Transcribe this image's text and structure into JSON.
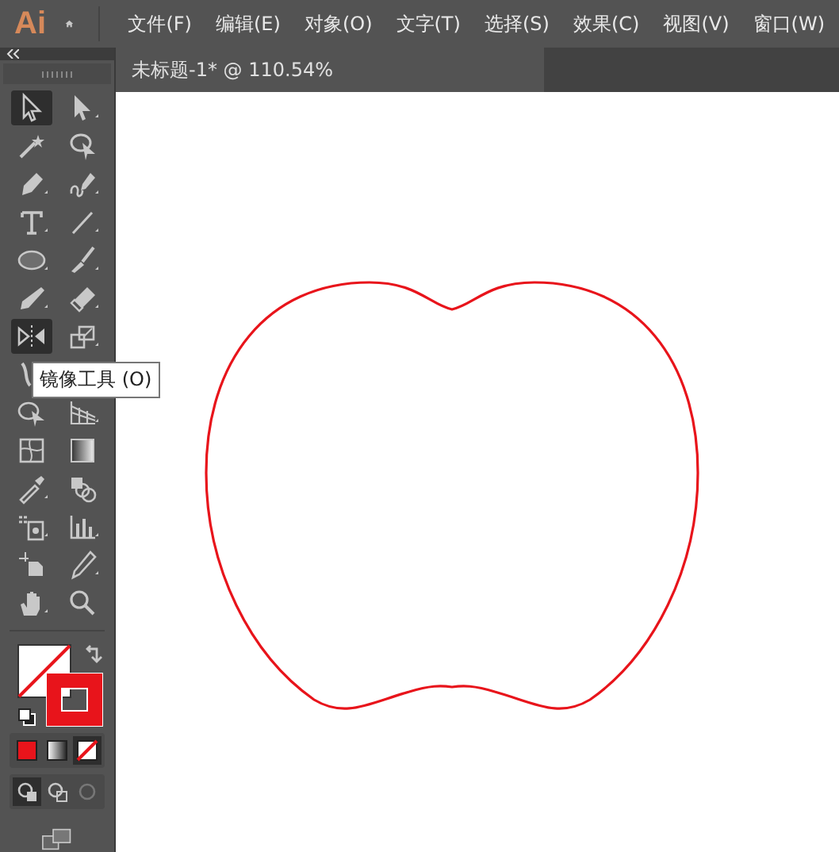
{
  "app": {
    "logo": "Ai"
  },
  "menu": [
    "文件(F)",
    "编辑(E)",
    "对象(O)",
    "文字(T)",
    "选择(S)",
    "效果(C)",
    "视图(V)",
    "窗口(W)"
  ],
  "document_tab": {
    "title": "未标题-1* @ 110.54%"
  },
  "tool_rows": [
    [
      {
        "kind": "selection",
        "selected": true
      },
      {
        "kind": "direct",
        "selected": false
      }
    ],
    [
      {
        "kind": "wand",
        "selected": false
      },
      {
        "kind": "lasso",
        "selected": false
      }
    ],
    [
      {
        "kind": "pen",
        "selected": false
      },
      {
        "kind": "curvature",
        "selected": false
      }
    ],
    [
      {
        "kind": "type",
        "selected": false
      },
      {
        "kind": "line",
        "selected": false
      }
    ],
    [
      {
        "kind": "ellipse",
        "selected": false
      },
      {
        "kind": "brush",
        "selected": false
      }
    ],
    [
      {
        "kind": "pencil",
        "selected": false
      },
      {
        "kind": "eraser",
        "selected": false
      }
    ],
    [
      {
        "kind": "reflect",
        "selected": true
      },
      {
        "kind": "scale",
        "selected": false
      }
    ],
    [
      {
        "kind": "width",
        "selected": false
      }
    ],
    [
      {
        "kind": "builder",
        "selected": false
      },
      {
        "kind": "perspective",
        "selected": false
      }
    ],
    [
      {
        "kind": "mesh",
        "selected": false
      },
      {
        "kind": "gradient",
        "selected": false
      }
    ],
    [
      {
        "kind": "eyedropper",
        "selected": false
      },
      {
        "kind": "blend",
        "selected": false
      }
    ],
    [
      {
        "kind": "sprayer",
        "selected": false
      },
      {
        "kind": "graph",
        "selected": false
      }
    ],
    [
      {
        "kind": "artboard",
        "selected": false
      },
      {
        "kind": "knife",
        "selected": false
      }
    ],
    [
      {
        "kind": "hand",
        "selected": false
      },
      {
        "kind": "zoom",
        "selected": false
      }
    ]
  ],
  "tooltip": "镜像工具 (O)",
  "color_modes": [
    {
      "kind": "color",
      "selected": false
    },
    {
      "kind": "gradient",
      "selected": false
    },
    {
      "kind": "none",
      "selected": true
    }
  ],
  "draw_modes": [
    {
      "kind": "normal",
      "selected": true
    },
    {
      "kind": "behind",
      "selected": false
    },
    {
      "kind": "inside",
      "selected": false
    }
  ]
}
